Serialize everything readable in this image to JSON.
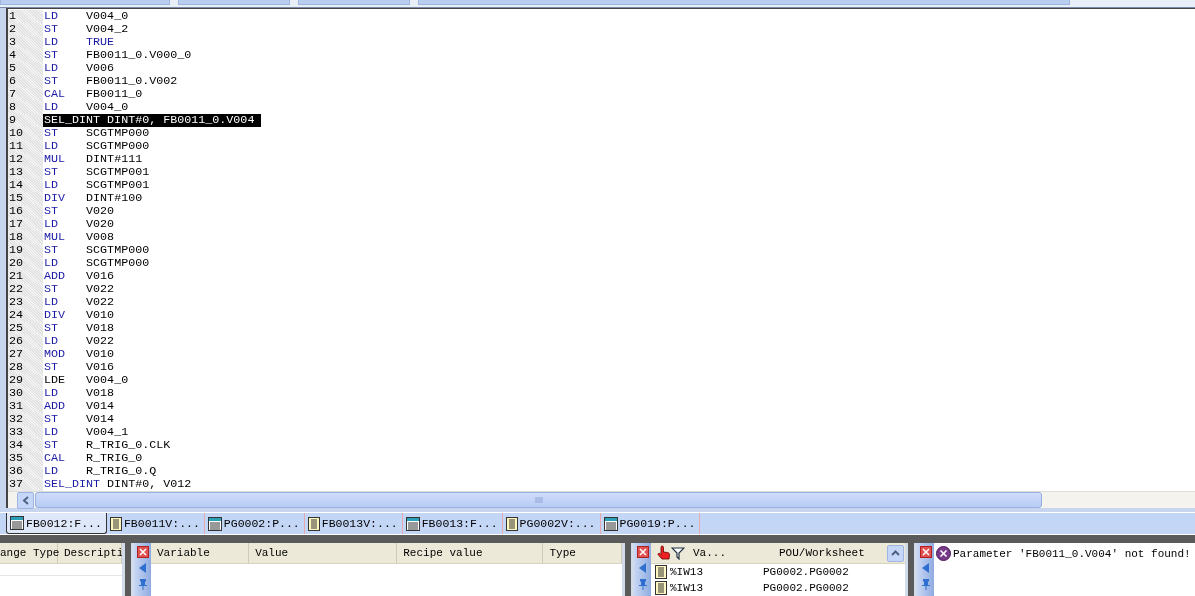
{
  "editor": {
    "lines": [
      {
        "number": "1",
        "op": "LD",
        "op_keyword": true,
        "operand": "V004_0",
        "operand_keyword": false,
        "selected": false
      },
      {
        "number": "2",
        "op": "ST",
        "op_keyword": true,
        "operand": "V004_2",
        "operand_keyword": false,
        "selected": false
      },
      {
        "number": "3",
        "op": "LD",
        "op_keyword": true,
        "operand": "TRUE",
        "operand_keyword": true,
        "selected": false
      },
      {
        "number": "4",
        "op": "ST",
        "op_keyword": true,
        "operand": "FB0011_0.V000_0",
        "operand_keyword": false,
        "selected": false
      },
      {
        "number": "5",
        "op": "LD",
        "op_keyword": true,
        "operand": "V006",
        "operand_keyword": false,
        "selected": false
      },
      {
        "number": "6",
        "op": "ST",
        "op_keyword": true,
        "operand": "FB0011_0.V002",
        "operand_keyword": false,
        "selected": false
      },
      {
        "number": "7",
        "op": "CAL",
        "op_keyword": true,
        "operand": "FB0011_0",
        "operand_keyword": false,
        "selected": false
      },
      {
        "number": "8",
        "op": "LD",
        "op_keyword": true,
        "operand": "V004_0",
        "operand_keyword": false,
        "selected": false
      },
      {
        "number": "9",
        "op": "SEL_DINT",
        "op_keyword": true,
        "operand": "DINT#0, FB0011_0.V004",
        "operand_keyword": false,
        "selected": true
      },
      {
        "number": "10",
        "op": "ST",
        "op_keyword": true,
        "operand": "SCGTMP000",
        "operand_keyword": false,
        "selected": false
      },
      {
        "number": "11",
        "op": "LD",
        "op_keyword": true,
        "operand": "SCGTMP000",
        "operand_keyword": false,
        "selected": false
      },
      {
        "number": "12",
        "op": "MUL",
        "op_keyword": true,
        "operand": "DINT#111",
        "operand_keyword": false,
        "selected": false
      },
      {
        "number": "13",
        "op": "ST",
        "op_keyword": true,
        "operand": "SCGTMP001",
        "operand_keyword": false,
        "selected": false
      },
      {
        "number": "14",
        "op": "LD",
        "op_keyword": true,
        "operand": "SCGTMP001",
        "operand_keyword": false,
        "selected": false
      },
      {
        "number": "15",
        "op": "DIV",
        "op_keyword": true,
        "operand": "DINT#100",
        "operand_keyword": false,
        "selected": false
      },
      {
        "number": "16",
        "op": "ST",
        "op_keyword": true,
        "operand": "V020",
        "operand_keyword": false,
        "selected": false
      },
      {
        "number": "17",
        "op": "LD",
        "op_keyword": true,
        "operand": "V020",
        "operand_keyword": false,
        "selected": false
      },
      {
        "number": "18",
        "op": "MUL",
        "op_keyword": true,
        "operand": "V008",
        "operand_keyword": false,
        "selected": false
      },
      {
        "number": "19",
        "op": "ST",
        "op_keyword": true,
        "operand": "SCGTMP000",
        "operand_keyword": false,
        "selected": false
      },
      {
        "number": "20",
        "op": "LD",
        "op_keyword": true,
        "operand": "SCGTMP000",
        "operand_keyword": false,
        "selected": false
      },
      {
        "number": "21",
        "op": "ADD",
        "op_keyword": true,
        "operand": "V016",
        "operand_keyword": false,
        "selected": false
      },
      {
        "number": "22",
        "op": "ST",
        "op_keyword": true,
        "operand": "V022",
        "operand_keyword": false,
        "selected": false
      },
      {
        "number": "23",
        "op": "LD",
        "op_keyword": true,
        "operand": "V022",
        "operand_keyword": false,
        "selected": false
      },
      {
        "number": "24",
        "op": "DIV",
        "op_keyword": true,
        "operand": "V010",
        "operand_keyword": false,
        "selected": false
      },
      {
        "number": "25",
        "op": "ST",
        "op_keyword": true,
        "operand": "V018",
        "operand_keyword": false,
        "selected": false
      },
      {
        "number": "26",
        "op": "LD",
        "op_keyword": true,
        "operand": "V022",
        "operand_keyword": false,
        "selected": false
      },
      {
        "number": "27",
        "op": "MOD",
        "op_keyword": true,
        "operand": "V010",
        "operand_keyword": false,
        "selected": false
      },
      {
        "number": "28",
        "op": "ST",
        "op_keyword": true,
        "operand": "V016",
        "operand_keyword": false,
        "selected": false
      },
      {
        "number": "29",
        "op": "LDE",
        "op_keyword": false,
        "operand": "V004_0",
        "operand_keyword": false,
        "selected": false
      },
      {
        "number": "30",
        "op": "LD",
        "op_keyword": true,
        "operand": "V018",
        "operand_keyword": false,
        "selected": false
      },
      {
        "number": "31",
        "op": "ADD",
        "op_keyword": true,
        "operand": "V014",
        "operand_keyword": false,
        "selected": false
      },
      {
        "number": "32",
        "op": "ST",
        "op_keyword": true,
        "operand": "V014",
        "operand_keyword": false,
        "selected": false
      },
      {
        "number": "33",
        "op": "LD",
        "op_keyword": true,
        "operand": "V004_1",
        "operand_keyword": false,
        "selected": false
      },
      {
        "number": "34",
        "op": "ST",
        "op_keyword": true,
        "operand": "R_TRIG_0.CLK",
        "operand_keyword": false,
        "selected": false
      },
      {
        "number": "35",
        "op": "CAL",
        "op_keyword": true,
        "operand": "R_TRIG_0",
        "operand_keyword": false,
        "selected": false
      },
      {
        "number": "36",
        "op": "LD",
        "op_keyword": true,
        "operand": "R_TRIG_0.Q",
        "operand_keyword": false,
        "selected": false
      },
      {
        "number": "37",
        "op": "SEL_DINT",
        "op_keyword": true,
        "operand": "DINT#0, V012",
        "operand_keyword": false,
        "selected": false
      }
    ]
  },
  "document_tabs": [
    {
      "label": "FB0012:F...",
      "kind": "code",
      "selected": true
    },
    {
      "label": "FB0011V:...",
      "kind": "variables",
      "selected": false
    },
    {
      "label": "PG0002:P...",
      "kind": "code",
      "selected": false
    },
    {
      "label": "FB0013V:...",
      "kind": "variables",
      "selected": false
    },
    {
      "label": "FB0013:F...",
      "kind": "code",
      "selected": false
    },
    {
      "label": "PG0002V:...",
      "kind": "variables",
      "selected": false
    },
    {
      "label": "PG0019:P...",
      "kind": "code",
      "selected": false
    }
  ],
  "properties_panel": {
    "columns": [
      "ange Type",
      "Descripti"
    ]
  },
  "watch_panel": {
    "columns": [
      "Variable",
      "Value",
      "Recipe value",
      "Type"
    ]
  },
  "crossref_panel": {
    "columns": [
      "Va...",
      "POU/Worksheet"
    ],
    "rows": [
      {
        "name": "%IW13",
        "location": "PG0002.PG0002"
      },
      {
        "name": "%IW13",
        "location": "PG0002.PG0002"
      }
    ]
  },
  "messages_panel": {
    "messages": [
      {
        "kind": "error",
        "text": "Parameter 'FB0011_0.V004' not found!"
      }
    ]
  }
}
